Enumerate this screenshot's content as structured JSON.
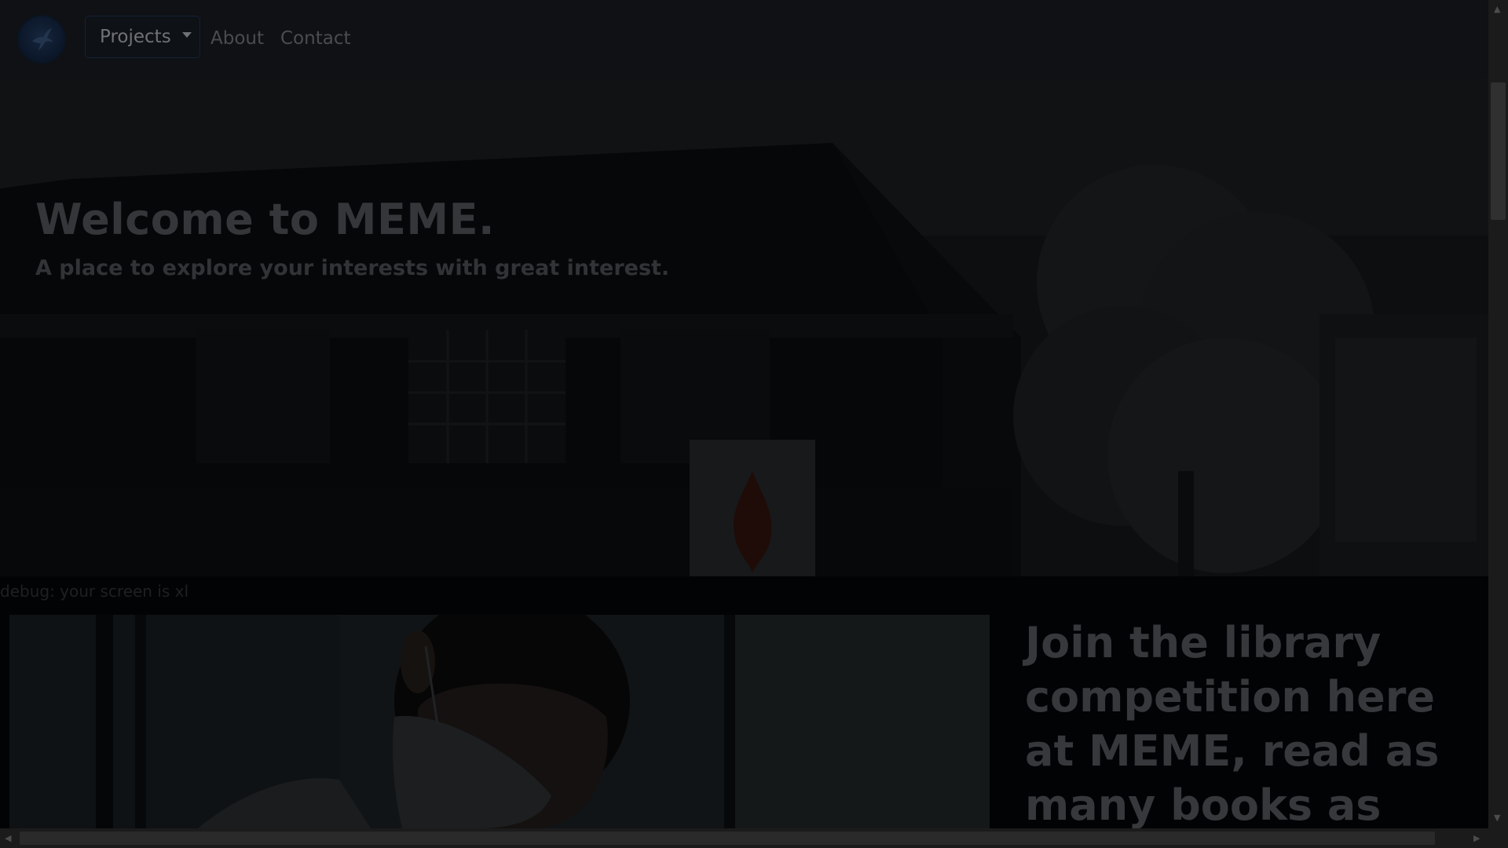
{
  "navbar": {
    "logo_icon": "hummingbird-logo-icon",
    "projects_label": "Projects",
    "about_label": "About",
    "contact_label": "Contact"
  },
  "hero": {
    "title": "Welcome to MEME.",
    "subtitle": "A place to explore your interests with great interest."
  },
  "debug": {
    "text": "debug: your screen is xl"
  },
  "competition": {
    "text": "Join the library competition here at MEME, read as many books as you can in"
  },
  "colors": {
    "overlay": "#000000",
    "navbar_bg": "#0f1114",
    "page_bg": "#020305"
  }
}
